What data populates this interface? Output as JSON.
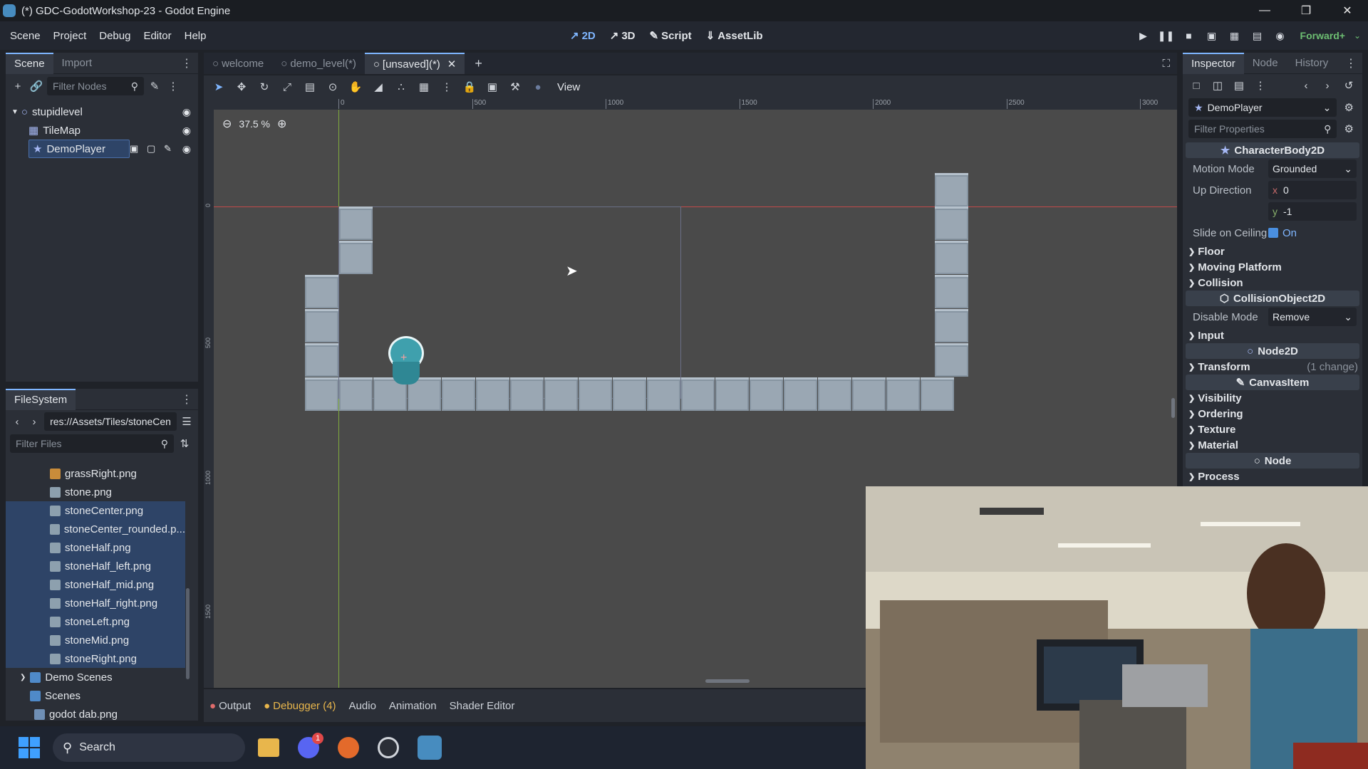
{
  "window": {
    "title": "(*) GDC-GodotWorkshop-23 - Godot Engine"
  },
  "menubar": {
    "menus": [
      "Scene",
      "Project",
      "Debug",
      "Editor",
      "Help"
    ],
    "modes": [
      {
        "label": "2D",
        "icon": "2d-icon"
      },
      {
        "label": "3D",
        "icon": "3d-icon"
      },
      {
        "label": "Script",
        "icon": "script-icon"
      },
      {
        "label": "AssetLib",
        "icon": "assetlib-icon"
      }
    ],
    "renderer": "Forward+"
  },
  "scene_dock": {
    "tabs": [
      "Scene",
      "Import"
    ],
    "filter_placeholder": "Filter Nodes",
    "nodes": [
      {
        "name": "stupidlevel",
        "icon": "node2d-icon"
      },
      {
        "name": "TileMap",
        "icon": "tilemap-icon"
      },
      {
        "name": "DemoPlayer",
        "icon": "characterbody2d-icon"
      }
    ]
  },
  "filesystem": {
    "tab": "FileSystem",
    "path": "res://Assets/Tiles/stoneCen",
    "filter_placeholder": "Filter Files",
    "files": [
      {
        "name": "grassRight.png",
        "selected": false,
        "kind": "grass"
      },
      {
        "name": "stone.png",
        "selected": false,
        "kind": "stone"
      },
      {
        "name": "stoneCenter.png",
        "selected": true,
        "kind": "stone"
      },
      {
        "name": "stoneCenter_rounded.p...",
        "selected": true,
        "kind": "stone"
      },
      {
        "name": "stoneHalf.png",
        "selected": true,
        "kind": "stone"
      },
      {
        "name": "stoneHalf_left.png",
        "selected": true,
        "kind": "stone"
      },
      {
        "name": "stoneHalf_mid.png",
        "selected": true,
        "kind": "stone"
      },
      {
        "name": "stoneHalf_right.png",
        "selected": true,
        "kind": "stone"
      },
      {
        "name": "stoneLeft.png",
        "selected": true,
        "kind": "stone"
      },
      {
        "name": "stoneMid.png",
        "selected": true,
        "kind": "stone"
      },
      {
        "name": "stoneRight.png",
        "selected": true,
        "kind": "stone"
      }
    ],
    "folders": [
      "Demo Scenes",
      "Scenes"
    ],
    "last_file": "godot dab.png"
  },
  "editor_tabs": [
    "welcome",
    "demo_level(*)",
    "[unsaved](*)"
  ],
  "toolbar": {
    "view_label": "View"
  },
  "viewport": {
    "zoom": "37.5 %",
    "ruler_marks": [
      "0",
      "500",
      "1000",
      "1500",
      "2000",
      "2500",
      "3000"
    ],
    "vruler_marks": [
      "0",
      "500",
      "1000",
      "1500"
    ]
  },
  "inspector": {
    "tabs": [
      "Inspector",
      "Node",
      "History"
    ],
    "selected_node": "DemoPlayer",
    "filter_placeholder": "Filter Properties",
    "class_header": "CharacterBody2D",
    "motion_mode_label": "Motion Mode",
    "motion_mode_value": "Grounded",
    "up_direction_label": "Up Direction",
    "up_x": "0",
    "up_y": "-1",
    "slide_label": "Slide on Ceiling",
    "slide_value": "On",
    "sections1": [
      "Floor",
      "Moving Platform",
      "Collision"
    ],
    "collision_object_header": "CollisionObject2D",
    "disable_mode_label": "Disable Mode",
    "disable_mode_value": "Remove",
    "input_section": "Input",
    "node2d_header": "Node2D",
    "transform_section": "Transform",
    "transform_change": "(1 change)",
    "canvasitem_header": "CanvasItem",
    "sections2": [
      "Visibility",
      "Ordering",
      "Texture",
      "Material"
    ],
    "node_header": "Node",
    "process_section": "Process"
  },
  "bottom_dock": {
    "tabs": [
      "Output",
      "Debugger (4)",
      "Audio",
      "Animation",
      "Shader Editor"
    ]
  },
  "taskbar": {
    "search": "Search",
    "discord_badge": "1"
  },
  "colors": {
    "accent": "#7fb6ff",
    "selection": "#2e4467",
    "renderer": "#6dbe72"
  }
}
